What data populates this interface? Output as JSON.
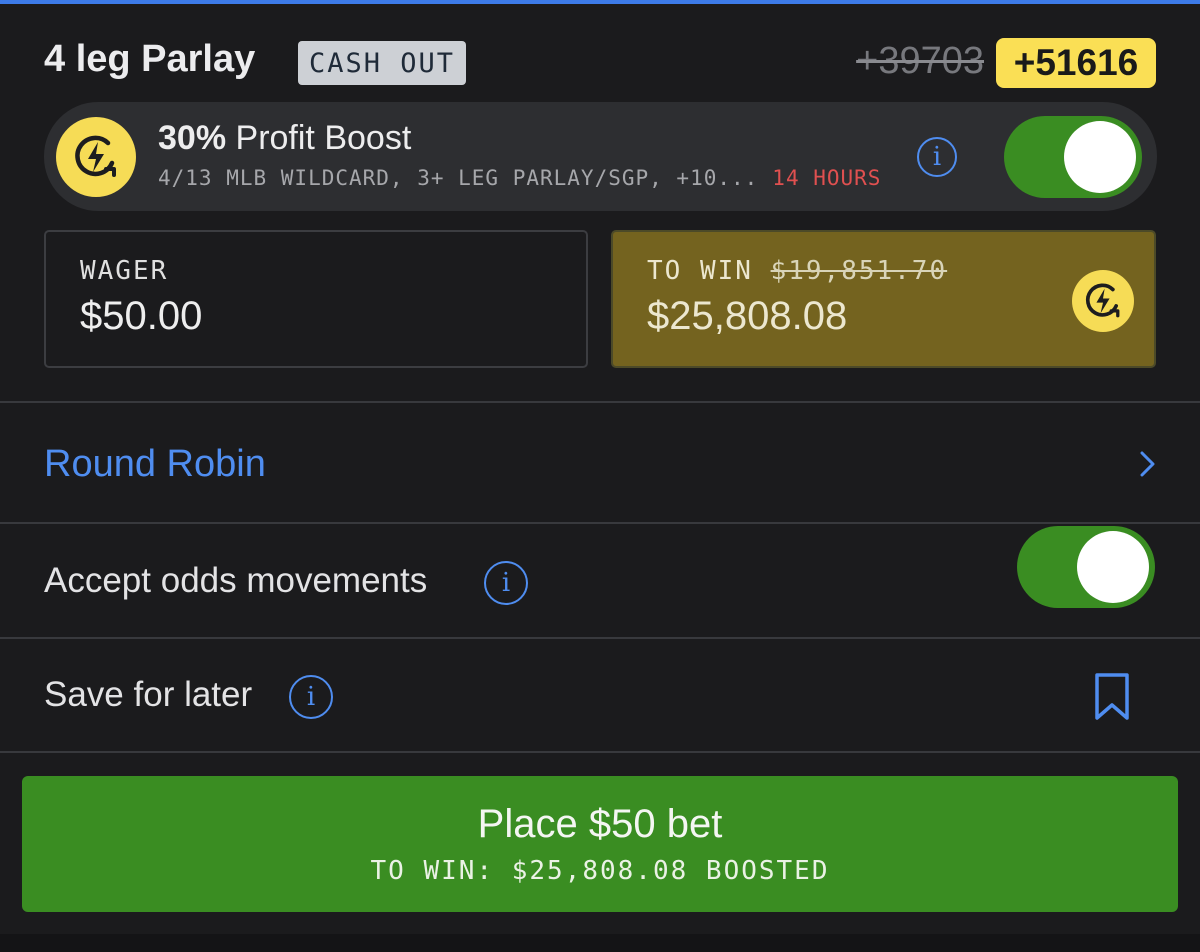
{
  "colors": {
    "accent_blue": "#4f8df0",
    "boost_yellow": "#f6dc56",
    "odds_badge_yellow": "#fadf55",
    "toggle_green": "#3a8d22",
    "to_win_bg": "#74631f",
    "expire_red": "#e05050",
    "background": "#1b1b1d"
  },
  "header": {
    "title": "4 leg Parlay",
    "cash_out_badge": "CASH OUT",
    "original_odds": "+39703",
    "boosted_odds": "+51616"
  },
  "boost": {
    "icon": "lightning-boost-icon",
    "percent": "30%",
    "label": "Profit Boost",
    "description": "4/13 MLB WILDCARD, 3+ LEG PARLAY/SGP, +10...",
    "expires": "14 HOURS",
    "info_icon": "info-icon",
    "enabled": true
  },
  "wager": {
    "label": "WAGER",
    "value": "$50.00"
  },
  "to_win": {
    "label": "TO WIN",
    "original_value": "$19,851.70",
    "value": "$25,808.08",
    "icon": "lightning-boost-icon"
  },
  "round_robin": {
    "label": "Round Robin",
    "icon": "chevron-right-icon"
  },
  "accept_odds": {
    "label": "Accept odds movements",
    "info_icon": "info-icon",
    "enabled": true
  },
  "save_later": {
    "label": "Save for later",
    "info_icon": "info-icon",
    "icon": "bookmark-icon"
  },
  "place_bet": {
    "label": "Place $50 bet",
    "sublabel": "TO WIN: $25,808.08 BOOSTED"
  }
}
